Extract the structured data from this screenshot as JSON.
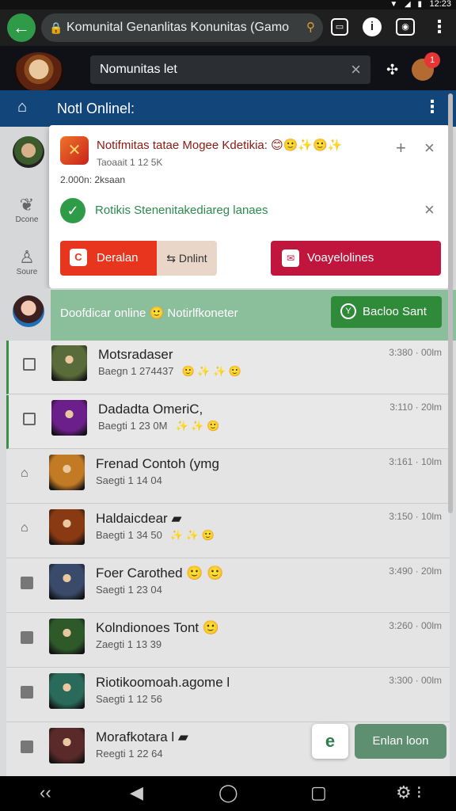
{
  "status_bar": {
    "icons": "▼ ◢ ▮",
    "time": "12:23"
  },
  "browser": {
    "url_title": "Komunital Genanlitas Konunitas (Gamo",
    "icons": [
      "back-arrow-icon",
      "lock-icon",
      "key-icon",
      "tabs-icon",
      "info-icon",
      "camera-icon",
      "kebab-icon"
    ]
  },
  "app_header": {
    "search_value": "Nomunitas let",
    "notification_count": "1"
  },
  "nav": {
    "title": "Notl Onlinel:"
  },
  "left_rail": {
    "items": [
      {
        "label": "Dcone"
      },
      {
        "label": "Soure"
      }
    ]
  },
  "popup": {
    "notif_title": "Notifmitas tatae Mogee Kdetikia: 😊🙂✨🙂✨",
    "notif_subtitle": "Taoaait 1 12 5K",
    "notif_meta": "2.000n: 2ksaan",
    "status_text": "Rotikis Stenenitakediareg lanaes",
    "btn_red_label": "Deralan",
    "btn_beige_label": "Dnlint",
    "btn_pink_label": "Voayelolines"
  },
  "online": {
    "text": "Doofdicar online  🙂  Notirlfkoneter",
    "button_label": "Bacloo Sant"
  },
  "games": [
    {
      "title": "Motsradaser",
      "sub": "Baegn 1 274437",
      "emoji": "🙂 ✨ ✨ 🙂",
      "time": "3:380 · 00lm",
      "check": "box",
      "hl": true,
      "color": "#5a6b3a"
    },
    {
      "title": "Dadadta OmeriC,",
      "sub": "Baegti 1 23 0M",
      "emoji": "✨ ✨ 🙂",
      "time": "3:110 · 20lm",
      "check": "box",
      "hl": true,
      "color": "#6b1f8a"
    },
    {
      "title": "Frenad Contoh (ymg",
      "sub": "Saegti 1 14 04",
      "emoji": "",
      "time": "3:161 · 10lm",
      "check": "home",
      "hl": false,
      "color": "#c27a25"
    },
    {
      "title": "Haldaicdear ▰",
      "sub": "Baegti 1 34 50",
      "emoji": "✨ ✨ 🙂",
      "time": "3:150 · 10lm",
      "check": "home",
      "hl": false,
      "color": "#8a3a12"
    },
    {
      "title": "Foer Carothed 🙂 🙂",
      "sub": "Saegti 1 23 04",
      "emoji": "",
      "time": "3:490 · 20lm",
      "check": "filled",
      "hl": false,
      "color": "#3a4a6a"
    },
    {
      "title": "Kolndionoes Tont 🙂",
      "sub": "Zaegti 1 13 39",
      "emoji": "",
      "time": "3:260 · 00lm",
      "check": "filled",
      "hl": false,
      "color": "#2e5a2a"
    },
    {
      "title": "Riotikoomoah.agome l",
      "sub": "Saegti 1 12 56",
      "emoji": "",
      "time": "3:300 · 00lm",
      "check": "filled",
      "hl": false,
      "color": "#2a6a5a"
    },
    {
      "title": "Morafkotara l ▰",
      "sub": "Reegti 1 22 64",
      "emoji": "",
      "time": "",
      "check": "filled",
      "hl": false,
      "color": "#5a2a2a"
    }
  ],
  "fab": {
    "e_label": "e",
    "main_label": "Enlan loon"
  },
  "android_nav": [
    "‹‹",
    "◀",
    "◯",
    "▢",
    "⚙ ⁝"
  ]
}
